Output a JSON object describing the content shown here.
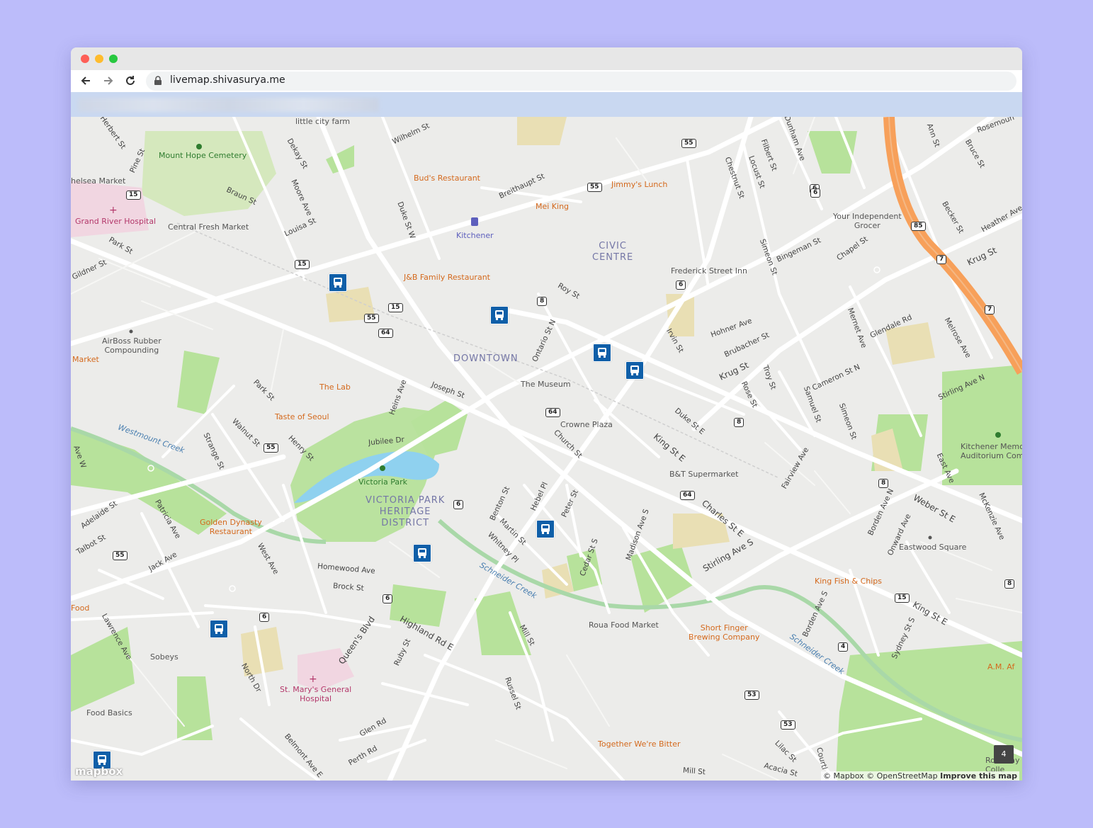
{
  "browser": {
    "url": "livemap.shivasurya.me",
    "back_icon": "arrow-left-icon",
    "forward_icon": "arrow-right-icon",
    "reload_icon": "reload-icon",
    "lock_icon": "lock-icon"
  },
  "map": {
    "districts": [
      {
        "id": "civic",
        "text": "CIVIC\nCENTRE"
      },
      {
        "id": "downtown",
        "text": "DOWNTOWN"
      },
      {
        "id": "victoria",
        "text": "VICTORIA PARK\nHERITAGE\nDISTRICT"
      }
    ],
    "pois": {
      "little_city_farm": "little city farm",
      "mount_hope": "Mount Hope Cemetery",
      "chelsea_market": "helsea Market",
      "grand_river": "Grand River Hospital",
      "central_fresh": "Central Fresh Market",
      "buds": "Bud's Restaurant",
      "kitchener": "Kitchener",
      "mei_king": "Mei King",
      "jimmys": "Jimmy's Lunch",
      "jb_family": "J&B Family Restaurant",
      "frederick_inn": "Frederick Street Inn",
      "your_independent": "Your Independent\nGrocer",
      "airboss": "AirBoss Rubber\nCompounding",
      "market_left": "Market",
      "the_lab": "The Lab",
      "the_museum": "The Museum",
      "taste_seoul": "Taste of Seoul",
      "crowne_plaza": "Crowne Plaza",
      "victoria_park": "Victoria Park",
      "bt_supermarket": "B&T Supermarket",
      "golden_dynasty": "Golden Dynasty\nRestaurant",
      "kitchener_memorial": "Kitchener Memo\nAuditorium Com",
      "eastwood": "Eastwood Square",
      "king_fish": "King Fish & Chips",
      "food_left": "Food",
      "sobeys": "Sobeys",
      "roua": "Roua Food Market",
      "short_finger": "Short Finger\nBrewing Company",
      "st_marys": "St. Mary's General\nHospital",
      "food_basics": "Food Basics",
      "together": "Together We're Bitter",
      "am_af": "A.M. Af",
      "rockway": "Rockway M\nColle"
    },
    "streets": {
      "herbert": "Herbert St",
      "wilhelm": "Wilhelm St",
      "pine": "Pine St",
      "dekay": "Dekay St",
      "braun": "Braun St",
      "moore": "Moore Ave",
      "louisa": "Louisa St",
      "duke_w": "Duke St W",
      "breithaupt": "Breithaupt St",
      "park": "Park St",
      "gildner": "Gildner St",
      "roy": "Roy St",
      "ontario": "Ontario St N",
      "irvin": "Irvin St",
      "hohner": "Hohner Ave",
      "brubacher": "Brubacher St",
      "krug": "Krug St",
      "krug_e": "Krug St",
      "rose": "Rose St",
      "troy": "Troy St",
      "samuel": "Samuel St",
      "simeon": "Simeon St",
      "simeon2": "Simeon St",
      "cameron": "Cameron St N",
      "glendale": "Glendale Rd",
      "melrose": "Melrose Ave",
      "stirling_n": "Stirling Ave N",
      "mernet": "Mernet Ave",
      "chapel": "Chapel St",
      "bingeman": "Bingeman St",
      "chestnut": "Chestnut St",
      "locust": "Locust St",
      "filbert": "Filbert St",
      "dunham": "Dunham Ave",
      "ann": "Ann St",
      "bruce": "Bruce St",
      "becker": "Becker St",
      "heather": "Heather Ave",
      "rosemount": "Rosemoun",
      "joseph": "Joseph St",
      "heins": "Heins Ave",
      "park2": "Park St",
      "walnut": "Walnut St",
      "henry": "Henry St",
      "strange": "Strange St",
      "jubilee": "Jubilee Dr",
      "church": "Church St",
      "king_e": "King St E",
      "king_e2": "King St E",
      "duke_e": "Duke St E",
      "charles": "Charles St E",
      "weber": "Weber St E",
      "east": "East Ave",
      "mckenzie": "McKenzie Ave",
      "borden": "Borden Ave N",
      "borden_s": "Borden Ave S",
      "onward": "Onward Ave",
      "fairview": "Fairview Ave",
      "stirling_s": "Stirling Ave S",
      "benton": "Benton St",
      "hebel": "Hebel Pl",
      "peter": "Peter St",
      "martin": "Martin St",
      "whitney": "Whitney Pl",
      "cedar": "Cedar St S",
      "madison": "Madison Ave S",
      "adelaide": "Adelaide St",
      "patricia": "Patricia Ave",
      "talbot": "Talbot St",
      "jack": "Jack Ave",
      "west": "West Ave",
      "homewood": "Homewood Ave",
      "brock": "Brock St",
      "queens": "Queen's Blvd",
      "highland": "Highland Rd E",
      "ruby": "Ruby St",
      "mill": "Mill St",
      "mill2": "Mill St",
      "russel": "Russel St",
      "lawrence": "Lawrence Ave",
      "north": "North Dr",
      "glen": "Glen Rd",
      "perth": "Perth Rd",
      "belmont": "Belmont Ave E",
      "lilac": "Lilac St",
      "acacia": "Acacia St",
      "courtland": "Courtl",
      "sydney": "Sydney St S",
      "ave_w": "Ave W"
    },
    "creeks": {
      "westmount": "Westmount Creek",
      "schneider1": "Schneider Creek",
      "schneider2": "Schneider Creek"
    },
    "shields": [
      "15",
      "15",
      "15",
      "15",
      "55",
      "55",
      "55",
      "55",
      "55",
      "6",
      "6",
      "6",
      "6",
      "6",
      "6",
      "8",
      "8",
      "8",
      "8",
      "64",
      "64",
      "64",
      "7",
      "7",
      "85",
      "4",
      "53",
      "53"
    ],
    "cluster_count": "4",
    "attribution": {
      "mapbox": "© Mapbox",
      "osm": "© OpenStreetMap",
      "improve": "Improve this map"
    },
    "logo": "mapbox",
    "colors": {
      "land": "#ececea",
      "park": "#b7e29b",
      "water": "#8fd1ef",
      "highway": "#f7a05a",
      "road": "#ffffff",
      "bus": "#0f5fa8",
      "hospital": "#f1d6e1",
      "sand": "#e9dfb4"
    }
  }
}
